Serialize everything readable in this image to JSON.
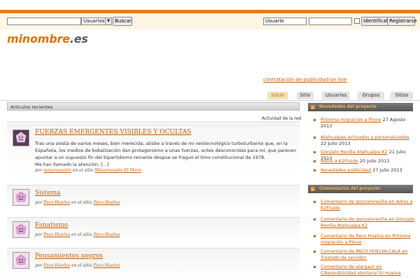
{
  "topbar": {
    "search_select": "Usuarios",
    "search_button": "Buscar",
    "user_field": "Usuario",
    "login_button": "Identifícate",
    "register_button": "Registrarse"
  },
  "logo": {
    "name": "minombre",
    "tld": ".es"
  },
  "ad_link": "contratación de publicidad on line",
  "tabs": [
    "Inicio",
    "Sitio",
    "Usuarios",
    "Grupos",
    "Sitios"
  ],
  "main": {
    "panel_title": "Artículos recientes",
    "activity_label": "Actividad de la red",
    "featured": {
      "title": "FUERZAS EMERGENTES VISIBLES Y OCULTAS",
      "body_lines": [
        "Tras una siesta de varios meses, bien merecida, atisbo a través de mi neotecnológico turboturbante que, en la",
        "Españeta, los medios de bobalización dan protagonismo a unas fuerzas, antes desconocidas para mí, que parecen",
        "apuntar a un supuesto fin del bipartidismo reinante despue se fraguó el timo constitucional de 1978.",
        "Me han llamado la atención, [...]"
      ],
      "meta_by": "por",
      "meta_user": "minomannlin",
      "meta_in": "en el sitio",
      "meta_site": "Minomanolin El Moro"
    },
    "articles": [
      {
        "title": "Sistema",
        "by": "por",
        "user": "Paco Huelva",
        "in": "en el sitio",
        "site": "Paco Huelva"
      },
      {
        "title": "Fanatismo",
        "by": "por",
        "user": "Paco Huelva",
        "in": "en el sitio",
        "site": "Paco Huelva"
      },
      {
        "title": "Pensamientos negros",
        "by": "por",
        "user": "Paco Huelva",
        "in": "en el sitio",
        "site": "Paco Huelva"
      }
    ]
  },
  "sidebar": {
    "news_title": "Novedades del proyecto",
    "news": [
      {
        "link": "Próxima migración a Plone",
        "date": "27 Agosto 2013"
      },
      {
        "link": "Atahualpas activados y personalizados",
        "date": "22 Julio 2013"
      },
      {
        "link": "Gonzalo Revilla Atahualpa-K2",
        "date": "21 Julio 2013"
      },
      {
        "link": "Adios a K2Fluido",
        "date": "20 Julio 2013"
      },
      {
        "link": "Novedades publicidad",
        "date": "27 Julio 2013"
      }
    ],
    "comments_title": "Comentarios del proyecto",
    "comments": [
      "Comentario de gonzalorevilla en Adios a K2Fluido",
      "Comentario de gonzalorevilla en Gonzalo Revilla Atahualpa-K2",
      "Comentario de Paco Huelva en Próxima migración a Plone",
      "Comentario de PACO HUELVA CALA en Traslado de servidor",
      "Comentario de alargaor en Ciberpublicidad electoral IU Huelva"
    ]
  }
}
